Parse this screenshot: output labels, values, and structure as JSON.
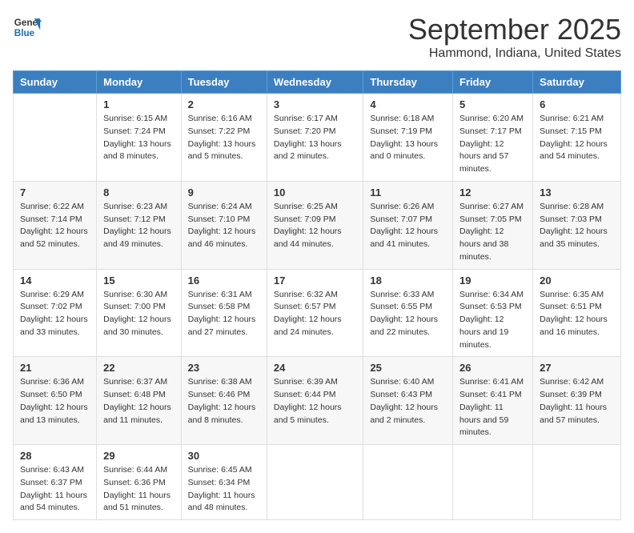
{
  "logo": {
    "line1": "General",
    "line2": "Blue"
  },
  "title": "September 2025",
  "subtitle": "Hammond, Indiana, United States",
  "days_header": [
    "Sunday",
    "Monday",
    "Tuesday",
    "Wednesday",
    "Thursday",
    "Friday",
    "Saturday"
  ],
  "weeks": [
    [
      {
        "day": "",
        "sunrise": "",
        "sunset": "",
        "daylight": ""
      },
      {
        "day": "1",
        "sunrise": "Sunrise: 6:15 AM",
        "sunset": "Sunset: 7:24 PM",
        "daylight": "Daylight: 13 hours and 8 minutes."
      },
      {
        "day": "2",
        "sunrise": "Sunrise: 6:16 AM",
        "sunset": "Sunset: 7:22 PM",
        "daylight": "Daylight: 13 hours and 5 minutes."
      },
      {
        "day": "3",
        "sunrise": "Sunrise: 6:17 AM",
        "sunset": "Sunset: 7:20 PM",
        "daylight": "Daylight: 13 hours and 2 minutes."
      },
      {
        "day": "4",
        "sunrise": "Sunrise: 6:18 AM",
        "sunset": "Sunset: 7:19 PM",
        "daylight": "Daylight: 13 hours and 0 minutes."
      },
      {
        "day": "5",
        "sunrise": "Sunrise: 6:20 AM",
        "sunset": "Sunset: 7:17 PM",
        "daylight": "Daylight: 12 hours and 57 minutes."
      },
      {
        "day": "6",
        "sunrise": "Sunrise: 6:21 AM",
        "sunset": "Sunset: 7:15 PM",
        "daylight": "Daylight: 12 hours and 54 minutes."
      }
    ],
    [
      {
        "day": "7",
        "sunrise": "Sunrise: 6:22 AM",
        "sunset": "Sunset: 7:14 PM",
        "daylight": "Daylight: 12 hours and 52 minutes."
      },
      {
        "day": "8",
        "sunrise": "Sunrise: 6:23 AM",
        "sunset": "Sunset: 7:12 PM",
        "daylight": "Daylight: 12 hours and 49 minutes."
      },
      {
        "day": "9",
        "sunrise": "Sunrise: 6:24 AM",
        "sunset": "Sunset: 7:10 PM",
        "daylight": "Daylight: 12 hours and 46 minutes."
      },
      {
        "day": "10",
        "sunrise": "Sunrise: 6:25 AM",
        "sunset": "Sunset: 7:09 PM",
        "daylight": "Daylight: 12 hours and 44 minutes."
      },
      {
        "day": "11",
        "sunrise": "Sunrise: 6:26 AM",
        "sunset": "Sunset: 7:07 PM",
        "daylight": "Daylight: 12 hours and 41 minutes."
      },
      {
        "day": "12",
        "sunrise": "Sunrise: 6:27 AM",
        "sunset": "Sunset: 7:05 PM",
        "daylight": "Daylight: 12 hours and 38 minutes."
      },
      {
        "day": "13",
        "sunrise": "Sunrise: 6:28 AM",
        "sunset": "Sunset: 7:03 PM",
        "daylight": "Daylight: 12 hours and 35 minutes."
      }
    ],
    [
      {
        "day": "14",
        "sunrise": "Sunrise: 6:29 AM",
        "sunset": "Sunset: 7:02 PM",
        "daylight": "Daylight: 12 hours and 33 minutes."
      },
      {
        "day": "15",
        "sunrise": "Sunrise: 6:30 AM",
        "sunset": "Sunset: 7:00 PM",
        "daylight": "Daylight: 12 hours and 30 minutes."
      },
      {
        "day": "16",
        "sunrise": "Sunrise: 6:31 AM",
        "sunset": "Sunset: 6:58 PM",
        "daylight": "Daylight: 12 hours and 27 minutes."
      },
      {
        "day": "17",
        "sunrise": "Sunrise: 6:32 AM",
        "sunset": "Sunset: 6:57 PM",
        "daylight": "Daylight: 12 hours and 24 minutes."
      },
      {
        "day": "18",
        "sunrise": "Sunrise: 6:33 AM",
        "sunset": "Sunset: 6:55 PM",
        "daylight": "Daylight: 12 hours and 22 minutes."
      },
      {
        "day": "19",
        "sunrise": "Sunrise: 6:34 AM",
        "sunset": "Sunset: 6:53 PM",
        "daylight": "Daylight: 12 hours and 19 minutes."
      },
      {
        "day": "20",
        "sunrise": "Sunrise: 6:35 AM",
        "sunset": "Sunset: 6:51 PM",
        "daylight": "Daylight: 12 hours and 16 minutes."
      }
    ],
    [
      {
        "day": "21",
        "sunrise": "Sunrise: 6:36 AM",
        "sunset": "Sunset: 6:50 PM",
        "daylight": "Daylight: 12 hours and 13 minutes."
      },
      {
        "day": "22",
        "sunrise": "Sunrise: 6:37 AM",
        "sunset": "Sunset: 6:48 PM",
        "daylight": "Daylight: 12 hours and 11 minutes."
      },
      {
        "day": "23",
        "sunrise": "Sunrise: 6:38 AM",
        "sunset": "Sunset: 6:46 PM",
        "daylight": "Daylight: 12 hours and 8 minutes."
      },
      {
        "day": "24",
        "sunrise": "Sunrise: 6:39 AM",
        "sunset": "Sunset: 6:44 PM",
        "daylight": "Daylight: 12 hours and 5 minutes."
      },
      {
        "day": "25",
        "sunrise": "Sunrise: 6:40 AM",
        "sunset": "Sunset: 6:43 PM",
        "daylight": "Daylight: 12 hours and 2 minutes."
      },
      {
        "day": "26",
        "sunrise": "Sunrise: 6:41 AM",
        "sunset": "Sunset: 6:41 PM",
        "daylight": "Daylight: 11 hours and 59 minutes."
      },
      {
        "day": "27",
        "sunrise": "Sunrise: 6:42 AM",
        "sunset": "Sunset: 6:39 PM",
        "daylight": "Daylight: 11 hours and 57 minutes."
      }
    ],
    [
      {
        "day": "28",
        "sunrise": "Sunrise: 6:43 AM",
        "sunset": "Sunset: 6:37 PM",
        "daylight": "Daylight: 11 hours and 54 minutes."
      },
      {
        "day": "29",
        "sunrise": "Sunrise: 6:44 AM",
        "sunset": "Sunset: 6:36 PM",
        "daylight": "Daylight: 11 hours and 51 minutes."
      },
      {
        "day": "30",
        "sunrise": "Sunrise: 6:45 AM",
        "sunset": "Sunset: 6:34 PM",
        "daylight": "Daylight: 11 hours and 48 minutes."
      },
      {
        "day": "",
        "sunrise": "",
        "sunset": "",
        "daylight": ""
      },
      {
        "day": "",
        "sunrise": "",
        "sunset": "",
        "daylight": ""
      },
      {
        "day": "",
        "sunrise": "",
        "sunset": "",
        "daylight": ""
      },
      {
        "day": "",
        "sunrise": "",
        "sunset": "",
        "daylight": ""
      }
    ]
  ]
}
